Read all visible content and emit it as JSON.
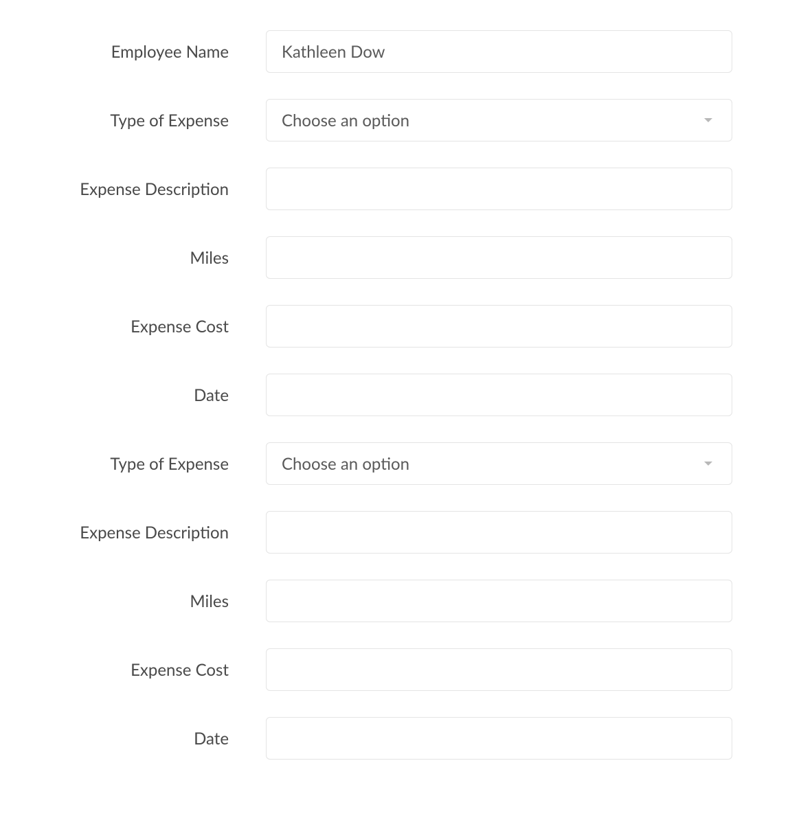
{
  "form": {
    "employee_name": {
      "label": "Employee Name",
      "value": "Kathleen Dow"
    },
    "expense1": {
      "type": {
        "label": "Type of Expense",
        "placeholder": "Choose an option",
        "value": ""
      },
      "description": {
        "label": "Expense Description",
        "value": ""
      },
      "miles": {
        "label": "Miles",
        "value": ""
      },
      "cost": {
        "label": "Expense Cost",
        "value": ""
      },
      "date": {
        "label": "Date",
        "value": ""
      }
    },
    "expense2": {
      "type": {
        "label": "Type of Expense",
        "placeholder": "Choose an option",
        "value": ""
      },
      "description": {
        "label": "Expense Description",
        "value": ""
      },
      "miles": {
        "label": "Miles",
        "value": ""
      },
      "cost": {
        "label": "Expense Cost",
        "value": ""
      },
      "date": {
        "label": "Date",
        "value": ""
      }
    }
  }
}
